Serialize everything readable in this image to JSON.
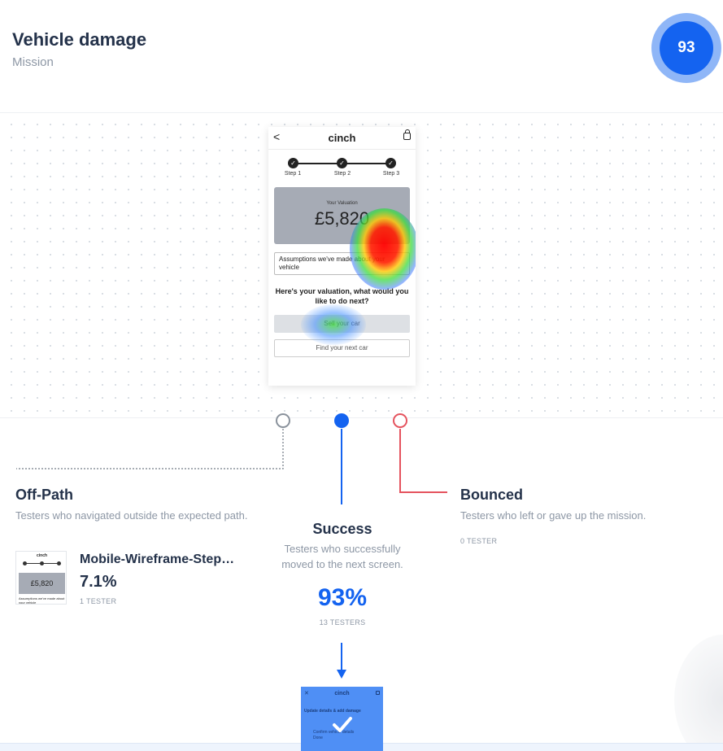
{
  "header": {
    "title": "Vehicle damage",
    "subtitle": "Mission",
    "score": "93"
  },
  "screen": {
    "back": "<",
    "brand": "cinch",
    "steps": [
      "Step 1",
      "Step 2",
      "Step 3"
    ],
    "valuation_label": "Your Valuation",
    "valuation": "£5,820",
    "assumptions": "Assumptions we've made about your vehicle",
    "question": "Here's your valuation, what would you like to do next?",
    "sell_label": "Sell your car",
    "find_label": "Find your next car"
  },
  "paths": {
    "off_path": {
      "title": "Off-Path",
      "description": "Testers who navigated outside the expected path.",
      "screen_name": "Mobile-Wireframe-Step…",
      "percent": "7.1%",
      "testers": "1 TESTER",
      "thumb_brand": "cinch",
      "thumb_value": "£5,820",
      "thumb_note": "Assumptions we've made about your vehicle"
    },
    "success": {
      "title": "Success",
      "description": "Testers who successfully moved to the next screen.",
      "percent": "93%",
      "testers": "13 TESTERS"
    },
    "bounced": {
      "title": "Bounced",
      "description": "Testers who left or gave up the mission.",
      "testers": "0 TESTER"
    }
  },
  "next_screen": {
    "brand": "cinch",
    "heading": "Update details & add damage",
    "item": "Confirm vehicle details",
    "item_sub": "Done",
    "check_icon": "check-icon"
  },
  "colors": {
    "accent": "#1463f0",
    "bounce": "#e5535e",
    "offpath": "#8a929c"
  }
}
